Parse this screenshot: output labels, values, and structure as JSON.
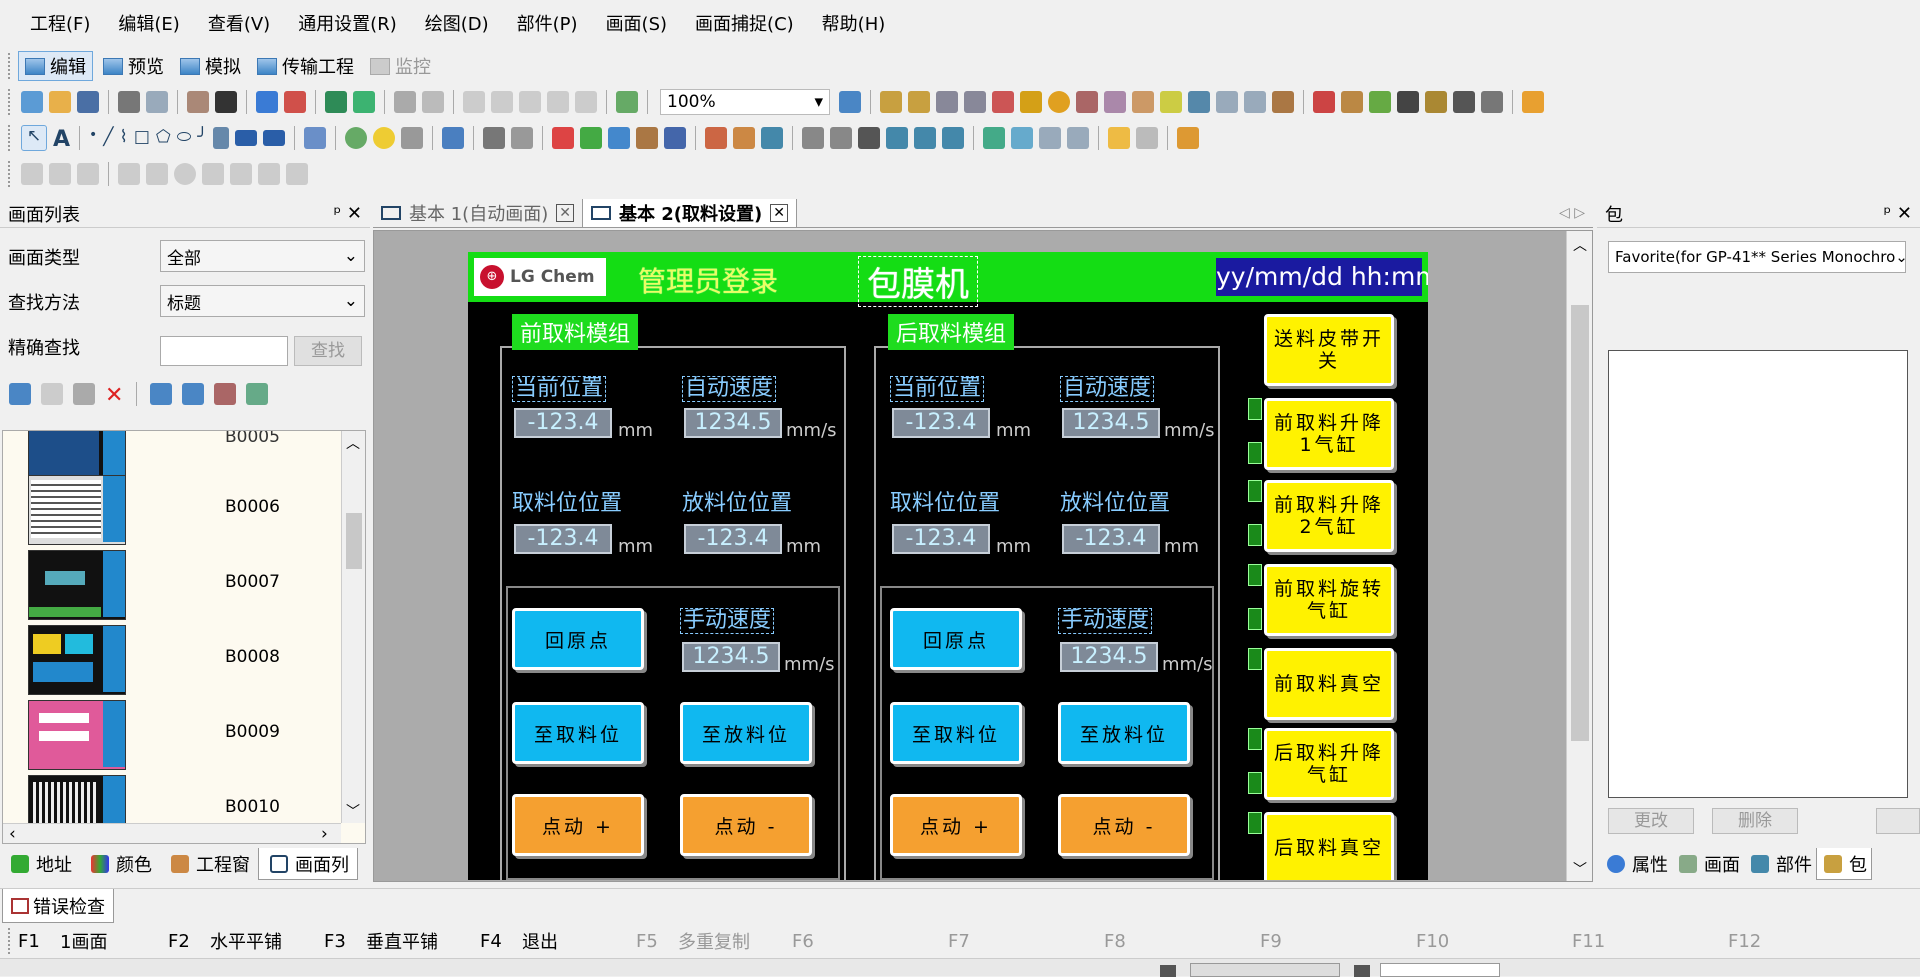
{
  "menu": [
    "工程(F)",
    "编辑(E)",
    "查看(V)",
    "通用设置(R)",
    "绘图(D)",
    "部件(P)",
    "画面(S)",
    "画面捕捉(C)",
    "帮助(H)"
  ],
  "modes": [
    {
      "label": "编辑",
      "active": true,
      "disabled": false
    },
    {
      "label": "预览",
      "active": false,
      "disabled": false
    },
    {
      "label": "模拟",
      "active": false,
      "disabled": false
    },
    {
      "label": "传输工程",
      "active": false,
      "disabled": false
    },
    {
      "label": "监控",
      "active": false,
      "disabled": true
    }
  ],
  "toolbar": {
    "zoom": "100%"
  },
  "left": {
    "title": "画面列表",
    "type_label": "画面类型",
    "type_value": "全部",
    "find_label": "查找方法",
    "find_value": "标题",
    "exact_label": "精确查找",
    "search_btn": "查找",
    "items": [
      "B0005",
      "B0006",
      "B0007",
      "B0008",
      "B0009",
      "B0010"
    ],
    "bottom_tabs": [
      "地址",
      "颜色",
      "工程窗",
      "画面列"
    ]
  },
  "tabs": [
    {
      "label": "基本 1(自动画面)",
      "active": false
    },
    {
      "label": "基本 2(取料设置)",
      "active": true
    }
  ],
  "screen": {
    "logo": "LG Chem",
    "admin": "管理员登录",
    "machine": "包膜机",
    "datetime": "yy/mm/dd hh:mm:ss",
    "front": {
      "title": "前取料模组",
      "cur_pos": "当前位置",
      "auto_speed": "自动速度",
      "cur_val": "-123.4",
      "auto_val": "1234.5",
      "pick_pos": "取料位位置",
      "place_pos": "放料位位置",
      "pick_val": "-123.4",
      "place_val": "-123.4",
      "manual_speed": "手动速度",
      "manual_val": "1234.5",
      "home": "回原点",
      "to_pick": "至取料位",
      "to_place": "至放料位",
      "jog_plus": "点动 +",
      "jog_minus": "点动 -"
    },
    "rear": {
      "title": "后取料模组",
      "cur_pos": "当前位置",
      "auto_speed": "自动速度",
      "cur_val": "-123.4",
      "auto_val": "1234.5",
      "pick_pos": "取料位位置",
      "place_pos": "放料位位置",
      "pick_val": "-123.4",
      "place_val": "-123.4",
      "manual_speed": "手动速度",
      "manual_val": "1234.5",
      "home": "回原点",
      "to_pick": "至取料位",
      "to_place": "至放料位",
      "jog_plus": "点动 +",
      "jog_minus": "点动 -"
    },
    "units": {
      "mm": "mm",
      "mms": "mm/s"
    },
    "side_buttons": [
      "送料皮带开关",
      "前取料升降\n1气缸",
      "前取料升降\n2气缸",
      "前取料旋转\n气缸",
      "前取料真空",
      "后取料升降\n气缸",
      "后取料真空"
    ]
  },
  "right": {
    "title": "包",
    "combo": "Favorite(for GP-41** Series Monochro",
    "btn_change": "更改",
    "btn_delete": "删除",
    "bottom_tabs": [
      "属性",
      "画面",
      "部件",
      "包"
    ]
  },
  "error_tab": "错误检查",
  "fkeys": [
    {
      "key": "F1",
      "label": "1画面",
      "enabled": true
    },
    {
      "key": "F2",
      "label": "水平平铺",
      "enabled": true
    },
    {
      "key": "F3",
      "label": "垂直平铺",
      "enabled": true
    },
    {
      "key": "F4",
      "label": "退出",
      "enabled": true
    },
    {
      "key": "F5",
      "label": "多重复制",
      "enabled": false
    },
    {
      "key": "F6",
      "label": "",
      "enabled": false
    },
    {
      "key": "F7",
      "label": "",
      "enabled": false
    },
    {
      "key": "F8",
      "label": "",
      "enabled": false
    },
    {
      "key": "F9",
      "label": "",
      "enabled": false
    },
    {
      "key": "F10",
      "label": "",
      "enabled": false
    },
    {
      "key": "F11",
      "label": "",
      "enabled": false
    },
    {
      "key": "F12",
      "label": "",
      "enabled": false
    }
  ],
  "colors": {
    "header_green": "#14dd14",
    "button_blue": "#10b8f0",
    "button_orange": "#f5a030",
    "button_yellow": "#fff200",
    "canvas_bg": "#000000"
  }
}
